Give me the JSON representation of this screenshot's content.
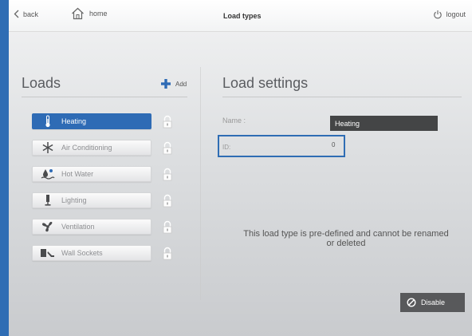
{
  "topbar": {
    "back_label": "back",
    "home_label": "home",
    "title": "Load types",
    "logout_label": "logout"
  },
  "loads": {
    "title": "Loads",
    "add_label": "Add",
    "items": [
      {
        "label": "Heating",
        "icon": "thermometer-icon",
        "active": true
      },
      {
        "label": "Air Conditioning",
        "icon": "snowflake-icon",
        "active": false
      },
      {
        "label": "Hot Water",
        "icon": "hot-water-icon",
        "active": false
      },
      {
        "label": "Lighting",
        "icon": "lamp-icon",
        "active": false
      },
      {
        "label": "Ventilation",
        "icon": "fan-icon",
        "active": false
      },
      {
        "label": "Wall Sockets",
        "icon": "socket-plug-icon",
        "active": false
      }
    ]
  },
  "settings": {
    "title": "Load settings",
    "name_label": "Name :",
    "name_value": "Heating",
    "id_label": "ID:",
    "id_value": "0",
    "info_text": "This load type is pre-defined and cannot be renamed or deleted",
    "disable_label": "Disable"
  },
  "colors": {
    "accent": "#2e6bb5",
    "dark_field": "#444546",
    "disable_button": "#58595b"
  }
}
